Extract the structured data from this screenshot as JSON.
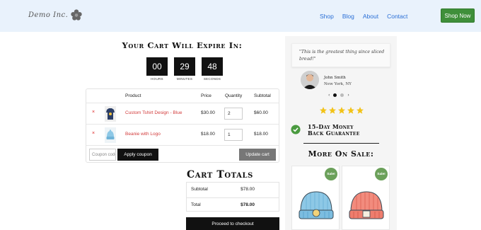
{
  "header": {
    "logo_text": "Demo Inc.",
    "nav": [
      "Shop",
      "Blog",
      "About",
      "Contact"
    ],
    "cta": "Shop Now",
    "colors": {
      "bg": "#e9f2fc",
      "link": "#2a6fd6",
      "cta": "#3f8f3a"
    }
  },
  "cart": {
    "expire_title": "Your Cart Will Expire In:",
    "timer": [
      {
        "value": "00",
        "label": "HOURS"
      },
      {
        "value": "29",
        "label": "MINUTES"
      },
      {
        "value": "48",
        "label": "SECONDS"
      }
    ],
    "columns": {
      "product": "Product",
      "price": "Price",
      "quantity": "Quantity",
      "subtotal": "Subtotal"
    },
    "items": [
      {
        "remove": "×",
        "name": "Custom Tshirt Design - Blue",
        "price": "$30.00",
        "qty": "2",
        "subtotal": "$60.00",
        "thumb_icon": "tshirt-icon"
      },
      {
        "remove": "×",
        "name": "Beanie with Logo",
        "price": "$18.00",
        "qty": "1",
        "subtotal": "$18.00",
        "thumb_icon": "beanie-icon"
      }
    ],
    "coupon_placeholder": "Coupon code",
    "apply_coupon": "Apply coupon",
    "update_cart": "Update cart"
  },
  "totals": {
    "title": "Cart Totals",
    "subtotal_label": "Subtotal",
    "subtotal_value": "$78.00",
    "total_label": "Total",
    "total_value": "$78.00",
    "checkout": "Proceed to checkout"
  },
  "sidebar": {
    "testimonial": {
      "quote": "\"This is the greatest thing since sliced bread!\"",
      "name": "John Smith",
      "location": "New York, NY"
    },
    "slider": {
      "prev": "‹",
      "next": "›",
      "dots": 3,
      "active": 0
    },
    "rating": 5,
    "guarantee": "15-Day Money Back Guarantee",
    "more_title": "More On Sale:",
    "products": [
      {
        "badge": "Sale!",
        "image": "blue-beanie-image",
        "color": "#8dc8e6"
      },
      {
        "badge": "Sale!",
        "image": "red-beanie-image",
        "color": "#f28b7d"
      }
    ],
    "colors": {
      "star": "#f2c318",
      "check": "#4a9a3f",
      "badge": "#6ba05a"
    }
  }
}
